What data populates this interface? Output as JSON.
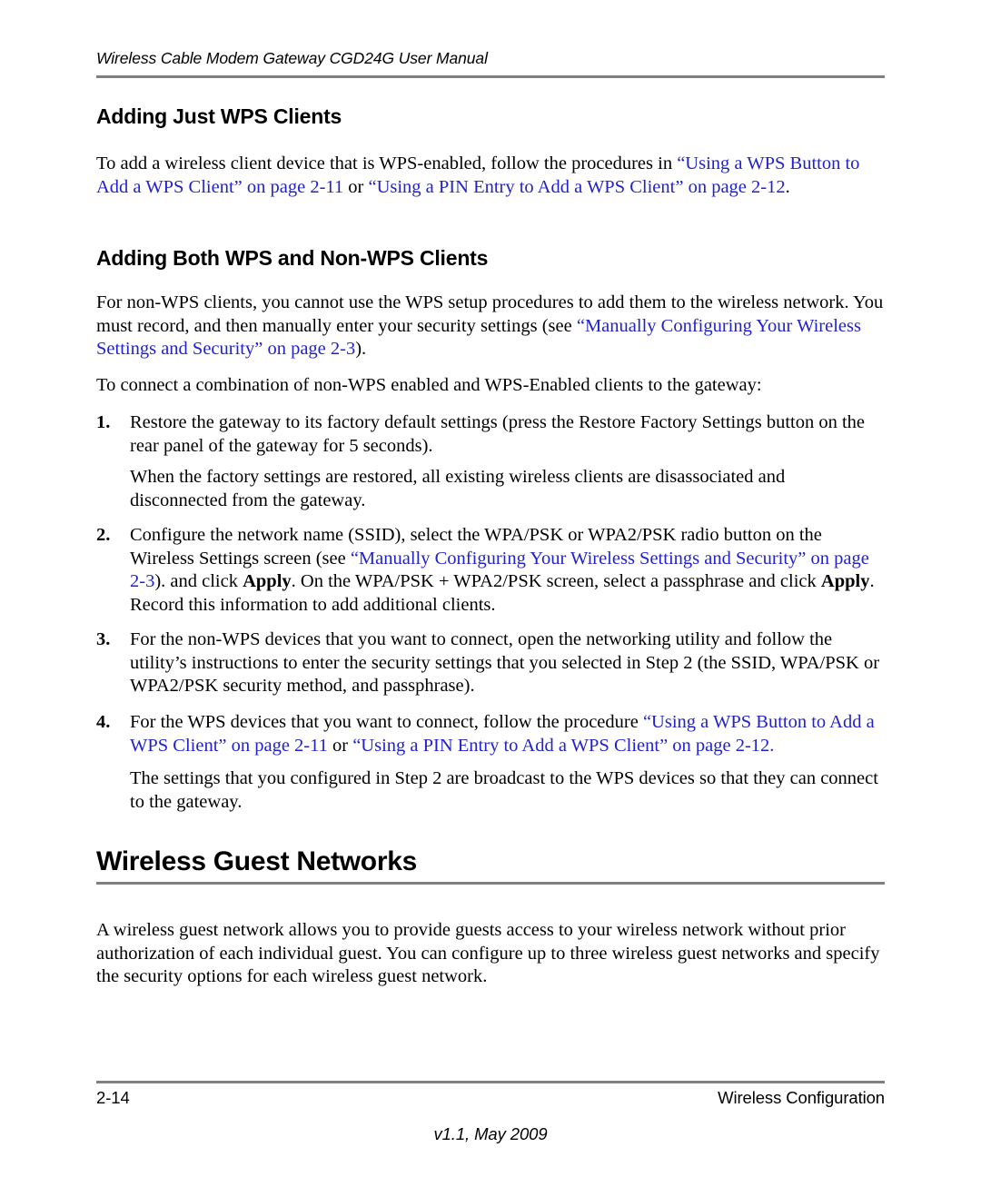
{
  "header": {
    "running_title": "Wireless Cable Modem Gateway CGD24G User Manual"
  },
  "sections": {
    "wps_clients_heading": "Adding Just WPS Clients",
    "wps_clients_para": {
      "t1": "To add a wireless client device that is WPS-enabled, follow the procedures in ",
      "link1": "“Using a WPS Button to Add a WPS Client” on page 2-11",
      "t2": " or ",
      "link2": "“Using a PIN Entry to Add a WPS Client” on page 2-12",
      "t3": "."
    },
    "both_heading": "Adding Both WPS and Non-WPS Clients",
    "both_para": {
      "t1": "For non-WPS clients, you cannot use the WPS setup procedures to add them to the wireless network. You must record, and then manually enter your security settings (see ",
      "link1": "“Manually Configuring Your Wireless Settings and Security” on page 2-3",
      "t2": ")."
    },
    "intro_para": "To connect a combination of non-WPS enabled and WPS-Enabled clients to the gateway:",
    "guest_heading": "Wireless Guest Networks",
    "guest_para": "A wireless guest network allows you to provide guests access to your wireless network without prior authorization of each individual guest. You can configure up to three wireless guest networks and specify the security options for each wireless guest network."
  },
  "steps": [
    {
      "number": "1.",
      "text": "Restore the gateway to its factory default settings (press the Restore Factory Settings button on the rear panel of the gateway for 5 seconds).",
      "continuation": "When the factory settings are restored, all existing wireless clients are disassociated and disconnected from the gateway."
    },
    {
      "number": "2.",
      "t1": "Configure the network name (SSID), select the WPA/PSK or WPA2/PSK radio button on the Wireless Settings screen (see ",
      "link1": "“Manually Configuring Your Wireless Settings and Security” on page 2-3",
      "t2": "). and click ",
      "bold1": "Apply",
      "t3": ". On the WPA/PSK + WPA2/PSK screen, select a passphrase and click ",
      "bold2": "Apply",
      "t4": ". Record this information to add additional clients."
    },
    {
      "number": "3.",
      "text": "For the non-WPS devices that you want to connect, open the networking utility and follow the utility’s instructions to enter the security settings that you selected in Step 2 (the SSID, WPA/PSK or WPA2/PSK security method, and passphrase)."
    },
    {
      "number": "4.",
      "t1": "For the WPS devices that you want to connect, follow the procedure ",
      "link1": "“Using a WPS Button to Add a WPS Client” on page 2-11",
      "t2": " or ",
      "link2": "“Using a PIN Entry to Add a WPS Client” on page 2-12.",
      "continuation": "The settings that you configured in Step 2 are broadcast to the WPS devices so that they can connect to the gateway."
    }
  ],
  "footer": {
    "page_number": "2-14",
    "chapter_title": "Wireless Configuration",
    "version": "v1.1, May 2009"
  },
  "colors": {
    "link": "#2222cc",
    "rule": "#808080",
    "text": "#000000"
  }
}
